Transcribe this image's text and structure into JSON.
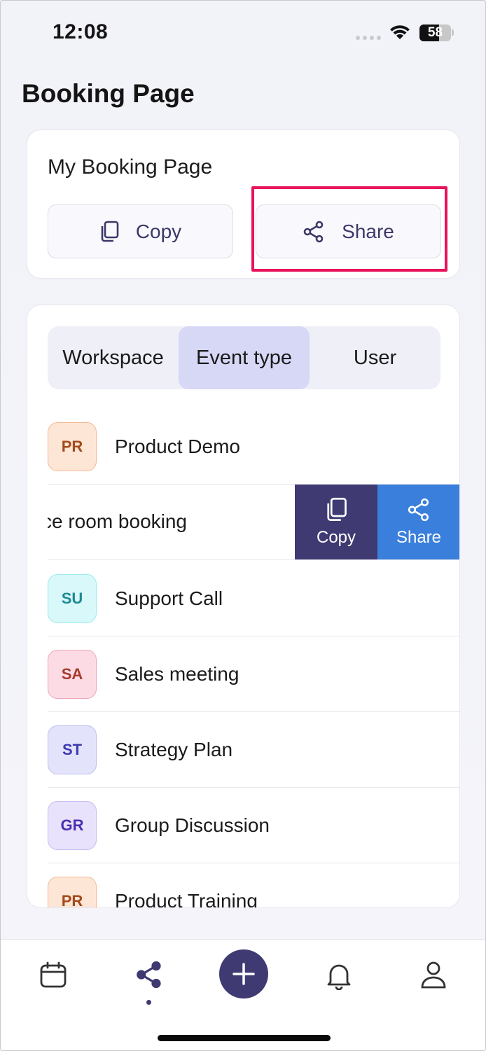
{
  "status_bar": {
    "time": "12:08",
    "battery": "58"
  },
  "header": {
    "title": "Booking Page"
  },
  "booking_card": {
    "label": "My Booking Page",
    "copy_label": "Copy",
    "share_label": "Share"
  },
  "tabs": [
    {
      "label": "Workspace",
      "active": false
    },
    {
      "label": "Event type",
      "active": true
    },
    {
      "label": "User",
      "active": false
    }
  ],
  "event_types": [
    {
      "initials": "PR",
      "name": "Product Demo",
      "color": "#f08a48",
      "bg": "#fde6d6",
      "text": "#a44a1c"
    },
    {
      "initials": "SU",
      "name": "Support Call",
      "color": "#7fe0e6",
      "bg": "#d8f8fa",
      "text": "#1e8a92"
    },
    {
      "initials": "SA",
      "name": "Sales meeting",
      "color": "#ef8aa3",
      "bg": "#fcdbe4",
      "text": "#a63a2c"
    },
    {
      "initials": "ST",
      "name": "Strategy Plan",
      "color": "#a9a9ec",
      "bg": "#e3e3fb",
      "text": "#3b3bb0"
    },
    {
      "initials": "GR",
      "name": "Group Discussion",
      "color": "#b9a9ee",
      "bg": "#e8e2fc",
      "text": "#4b2fb0"
    },
    {
      "initials": "PR",
      "name": "Product Training",
      "color": "#f08a48",
      "bg": "#fde6d6",
      "text": "#a44a1c"
    }
  ],
  "swiped_item": {
    "visible_text": "ce room booking",
    "copy_label": "Copy",
    "share_label": "Share"
  },
  "colors": {
    "primary": "#3f3a72",
    "share_blue": "#3a7fdc",
    "highlight": "#e8135c",
    "active_tab": "#d7d7f6"
  },
  "bottom_nav": {
    "items": [
      "calendar-icon",
      "share-icon",
      "add-icon",
      "bell-icon",
      "profile-icon"
    ],
    "active": "share-icon"
  }
}
